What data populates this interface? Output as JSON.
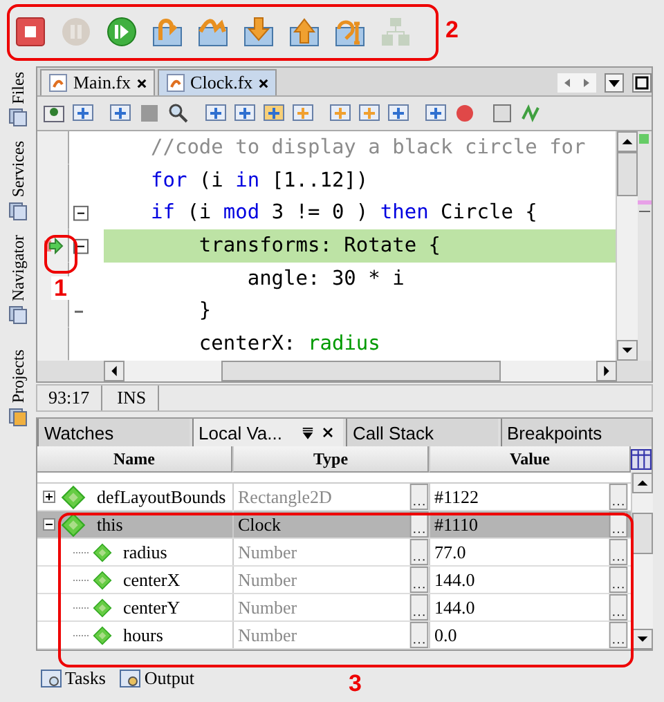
{
  "debug_toolbar": {
    "buttons": [
      {
        "kind": "stop",
        "disabled": false
      },
      {
        "kind": "pause",
        "disabled": true
      },
      {
        "kind": "continue",
        "disabled": false
      },
      {
        "kind": "step-over",
        "disabled": false
      },
      {
        "kind": "step-over-expr",
        "disabled": false
      },
      {
        "kind": "step-into",
        "disabled": false
      },
      {
        "kind": "step-out",
        "disabled": false
      },
      {
        "kind": "run-to-cursor",
        "disabled": false
      },
      {
        "kind": "apply-changes",
        "disabled": true
      }
    ]
  },
  "side_tabs": [
    "Files",
    "Services",
    "Navigator",
    "Projects"
  ],
  "editor": {
    "tabs": [
      {
        "label": "Main.fx",
        "selected": false
      },
      {
        "label": "Clock.fx",
        "selected": true
      }
    ],
    "lines": [
      {
        "fold_toggle": false,
        "fold_end": false,
        "current": false,
        "tokens": [
          {
            "kind": "comment",
            "text": "//code to display a black circle for"
          }
        ]
      },
      {
        "fold_toggle": false,
        "fold_end": false,
        "current": false,
        "tokens": [
          {
            "kind": "keyword",
            "text": "for"
          },
          {
            "kind": "plain",
            "text": " (i "
          },
          {
            "kind": "keyword",
            "text": "in"
          },
          {
            "kind": "plain",
            "text": " [1..12])"
          }
        ]
      },
      {
        "fold_toggle": true,
        "fold_end": false,
        "current": false,
        "tokens": [
          {
            "kind": "keyword",
            "text": "if"
          },
          {
            "kind": "plain",
            "text": " (i "
          },
          {
            "kind": "keyword",
            "text": "mod"
          },
          {
            "kind": "plain",
            "text": " 3 != 0 ) "
          },
          {
            "kind": "keyword",
            "text": "then"
          },
          {
            "kind": "plain",
            "text": " Circle {"
          }
        ]
      },
      {
        "fold_toggle": true,
        "fold_end": false,
        "current": true,
        "tokens": [
          {
            "kind": "plain",
            "text": "    transforms: Rotate {"
          }
        ]
      },
      {
        "fold_toggle": false,
        "fold_end": false,
        "current": false,
        "tokens": [
          {
            "kind": "plain",
            "text": "        angle: 30 * i"
          }
        ]
      },
      {
        "fold_toggle": false,
        "fold_end": true,
        "current": false,
        "tokens": [
          {
            "kind": "plain",
            "text": "    }"
          }
        ]
      },
      {
        "fold_toggle": false,
        "fold_end": false,
        "current": false,
        "tokens": [
          {
            "kind": "plain",
            "text": "    centerX: "
          },
          {
            "kind": "field",
            "text": "radius"
          }
        ]
      }
    ],
    "status": {
      "position": "93:17",
      "mode": "INS"
    }
  },
  "debugger": {
    "tabs": [
      {
        "label": "Watches",
        "selected": false
      },
      {
        "label": "Local Va...",
        "selected": true
      },
      {
        "label": "Call Stack",
        "selected": false
      },
      {
        "label": "Breakpoints",
        "selected": false
      }
    ],
    "columns": [
      "Name",
      "Type",
      "Value"
    ],
    "rows": [
      {
        "name": "defLayoutBounds",
        "type": "Rectangle2D",
        "value": "#1122",
        "expanded": false,
        "selected": false
      },
      {
        "name": "this",
        "type": "Clock",
        "value": "#1110",
        "expanded": true,
        "selected": true,
        "children": [
          {
            "name": "radius",
            "type": "Number",
            "value": "77.0",
            "selected": false
          },
          {
            "name": "centerX",
            "type": "Number",
            "value": "144.0",
            "selected": false
          },
          {
            "name": "centerY",
            "type": "Number",
            "value": "144.0",
            "selected": false
          },
          {
            "name": "hours",
            "type": "Number",
            "value": "0.0",
            "selected": false
          }
        ]
      }
    ]
  },
  "bottom_bar": [
    "Tasks",
    "Output"
  ],
  "callouts": [
    "2",
    "1",
    "3"
  ]
}
